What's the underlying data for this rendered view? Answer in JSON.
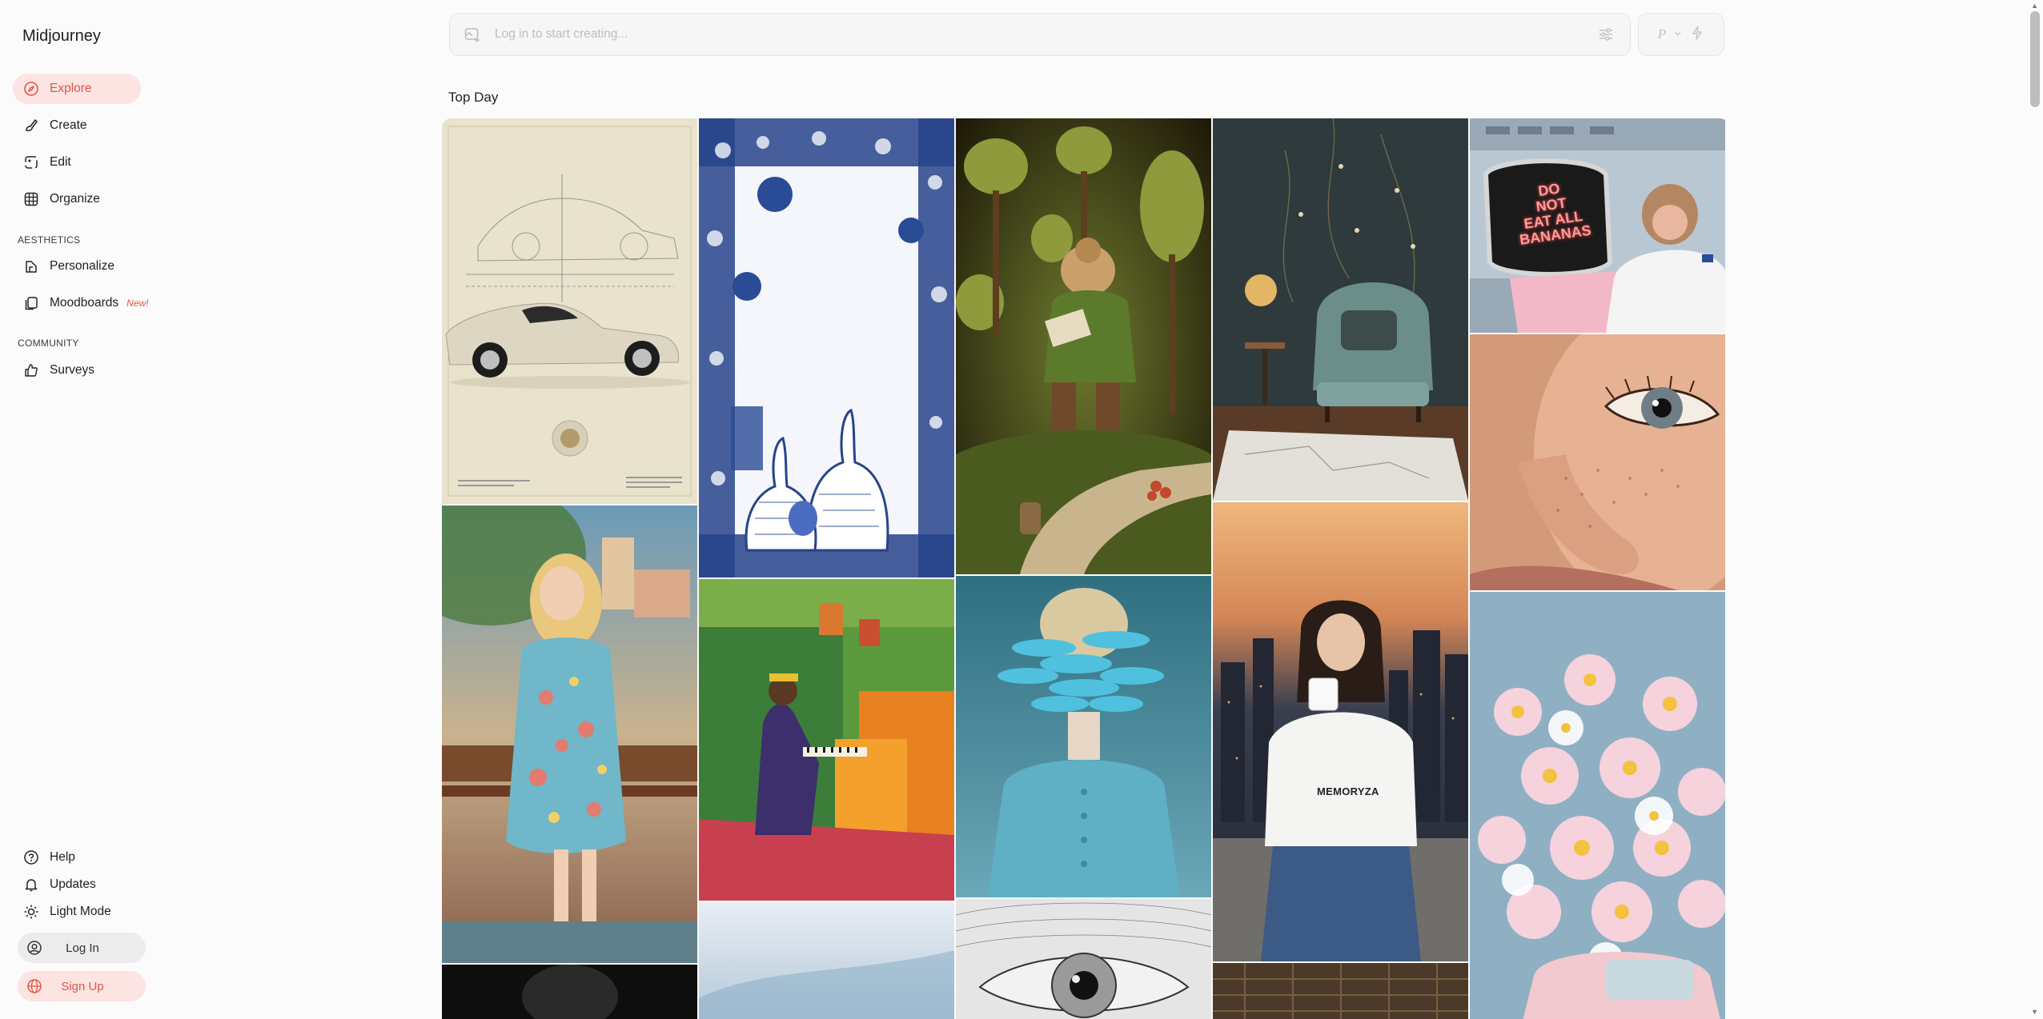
{
  "app": {
    "name": "Midjourney"
  },
  "nav": {
    "explore": "Explore",
    "create": "Create",
    "edit": "Edit",
    "organize": "Organize",
    "aesthetics_label": "AESTHETICS",
    "personalize": "Personalize",
    "moodboards": "Moodboards",
    "moodboards_badge": "New!",
    "community_label": "COMMUNITY",
    "surveys": "Surveys",
    "help": "Help",
    "updates": "Updates",
    "light_mode": "Light Mode",
    "login": "Log In",
    "signup": "Sign Up"
  },
  "prompt": {
    "placeholder": "Log in to start creating...",
    "mode_letter": "P"
  },
  "feed": {
    "title": "Top Day",
    "tile_texts": {
      "monkey_screen": [
        "DO",
        "NOT",
        "EAT ALL",
        "BANANAS"
      ],
      "tshirt": "MEMORYZA"
    }
  },
  "colors": {
    "accent": "#e25645",
    "accent_bg": "#fce4e2"
  },
  "icons": {
    "explore": "compass-icon",
    "create": "brush-icon",
    "edit": "edit-image-icon",
    "organize": "grid-icon",
    "personalize": "personalize-icon",
    "moodboards": "moodboard-icon",
    "surveys": "thumbs-up-icon",
    "help": "help-icon",
    "updates": "bell-icon",
    "light_mode": "sun-icon",
    "login": "user-circle-icon",
    "signup": "globe-icon"
  }
}
